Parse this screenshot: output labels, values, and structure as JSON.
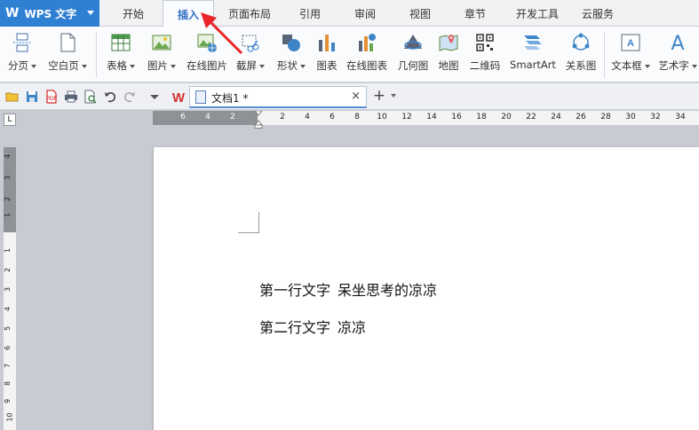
{
  "app": {
    "name": "WPS 文字"
  },
  "menu": {
    "tabs": [
      {
        "label": "开始"
      },
      {
        "label": "插入"
      },
      {
        "label": "页面布局"
      },
      {
        "label": "引用"
      },
      {
        "label": "审阅"
      },
      {
        "label": "视图"
      },
      {
        "label": "章节"
      },
      {
        "label": "开发工具"
      },
      {
        "label": "云服务"
      }
    ],
    "active": "插入"
  },
  "ribbon": {
    "buttons": [
      {
        "label": "分页",
        "icon": "page-break-icon",
        "dropdown": true
      },
      {
        "label": "空白页",
        "icon": "blank-page-icon",
        "dropdown": true
      },
      {
        "label": "表格",
        "icon": "table-icon",
        "dropdown": true
      },
      {
        "label": "图片",
        "icon": "picture-icon",
        "dropdown": true
      },
      {
        "label": "在线图片",
        "icon": "online-picture-icon",
        "dropdown": false
      },
      {
        "label": "截屏",
        "icon": "screenshot-icon",
        "dropdown": true
      },
      {
        "label": "形状",
        "icon": "shapes-icon",
        "dropdown": true
      },
      {
        "label": "图表",
        "icon": "chart-icon",
        "dropdown": false
      },
      {
        "label": "在线图表",
        "icon": "online-chart-icon",
        "dropdown": false
      },
      {
        "label": "几何图",
        "icon": "geometry-icon",
        "dropdown": false
      },
      {
        "label": "地图",
        "icon": "map-icon",
        "dropdown": false
      },
      {
        "label": "二维码",
        "icon": "qrcode-icon",
        "dropdown": false
      },
      {
        "label": "SmartArt",
        "icon": "smartart-icon",
        "dropdown": false
      },
      {
        "label": "关系图",
        "icon": "relation-icon",
        "dropdown": false
      },
      {
        "label": "文本框",
        "icon": "textbox-icon",
        "dropdown": true
      },
      {
        "label": "艺术字",
        "icon": "wordart-icon",
        "dropdown": true
      }
    ]
  },
  "quick_access": {
    "icons": [
      "open-icon",
      "save-icon",
      "export-pdf-icon",
      "print-icon",
      "print-preview-icon",
      "undo-icon",
      "redo-icon",
      "customize-dropdown-icon"
    ]
  },
  "doc_tab": {
    "title": "文档1 *",
    "close": "×"
  },
  "new_tab": {
    "label": "+"
  },
  "hruler": {
    "labels_left": [
      "6",
      "4",
      "2"
    ],
    "labels_right": [
      "2",
      "4",
      "6",
      "8",
      "10",
      "12",
      "14",
      "16",
      "18",
      "20",
      "22",
      "24",
      "26",
      "28",
      "30",
      "32",
      "34"
    ]
  },
  "vruler": {
    "labels_top": [
      "4",
      "3",
      "2",
      "1"
    ],
    "labels_bottom": [
      "1",
      "2",
      "3",
      "4",
      "5",
      "6",
      "7",
      "8",
      "9",
      "10"
    ]
  },
  "corner_label": "L",
  "document": {
    "lines": [
      {
        "part1": "第一行文字",
        "part2": "呆坐思考的凉凉"
      },
      {
        "part1": "第二行文字",
        "part2": "凉凉"
      }
    ]
  },
  "colors": {
    "app_blue": "#2f7fd2",
    "active_tab_text": "#2f6fc6",
    "arrow_red": "#e8262a"
  }
}
